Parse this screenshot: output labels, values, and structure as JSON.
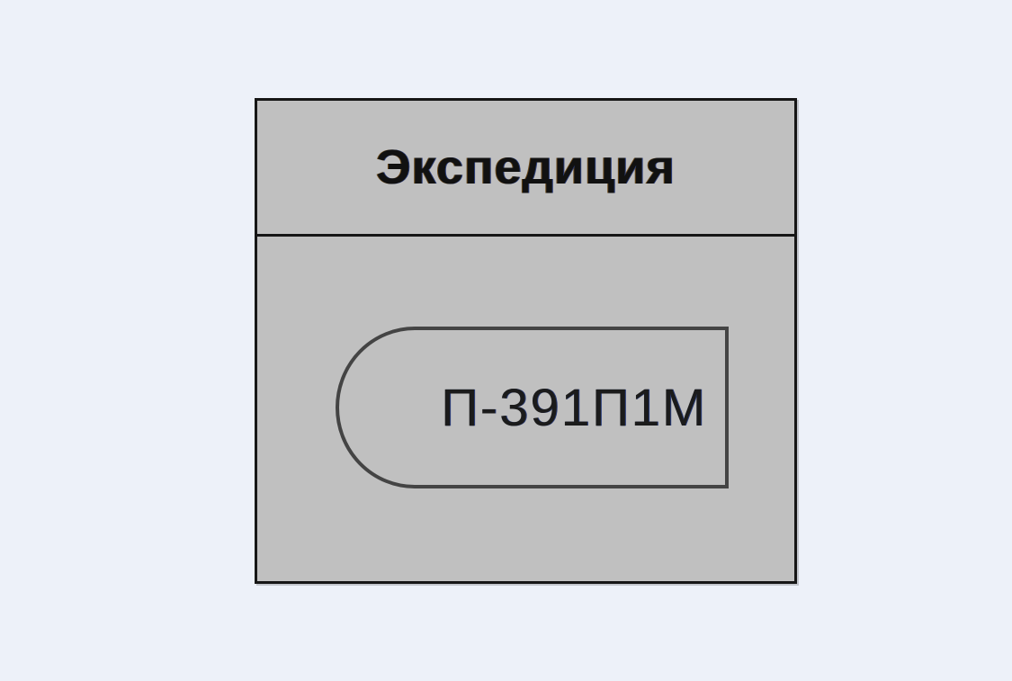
{
  "diagram": {
    "lane": {
      "title": "Экспедиция",
      "fill_color": "#c0c0c0",
      "border_color": "#161616"
    },
    "node": {
      "label": "П-391П1М",
      "shape": "terminal-rounded-left",
      "stroke_color": "#444444"
    },
    "background_color": "#edf1f9"
  }
}
